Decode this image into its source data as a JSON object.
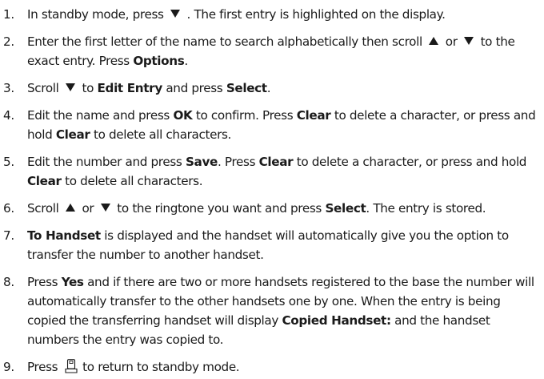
{
  "steps": [
    {
      "number": "1.",
      "parts": [
        "In standby mode, press ",
        " . The first entry is highlighted on the display."
      ],
      "icons": [
        "arrow-down-icon"
      ]
    },
    {
      "number": "2.",
      "parts": [
        "Enter the first letter of the name to search alphabetically then scroll ",
        " or ",
        " to the exact entry. Press ",
        "Options",
        "."
      ],
      "icons": [
        "arrow-up-icon",
        "arrow-down-icon"
      ]
    },
    {
      "number": "3.",
      "parts": [
        "Scroll ",
        " to ",
        "Edit Entry",
        " and press ",
        "Select",
        "."
      ],
      "icons": [
        "arrow-down-icon"
      ]
    },
    {
      "number": "4.",
      "parts": [
        "Edit the name and press ",
        "OK",
        " to confirm. Press ",
        "Clear",
        " to delete a character, or press and hold ",
        "Clear",
        " to delete all characters."
      ]
    },
    {
      "number": "5.",
      "parts": [
        "Edit the number and press ",
        "Save",
        ". Press ",
        "Clear",
        " to delete a character, or press and hold ",
        "Clear",
        " to delete all characters."
      ]
    },
    {
      "number": "6.",
      "parts": [
        "Scroll ",
        " or ",
        " to the ringtone you want and press ",
        "Select",
        ". The entry is stored."
      ],
      "icons": [
        "arrow-up-icon",
        "arrow-down-icon"
      ]
    },
    {
      "number": "7.",
      "parts": [
        "To Handset",
        " is displayed and the handset will automatically give you the option to transfer the number to another handset."
      ]
    },
    {
      "number": "8.",
      "parts": [
        "Press ",
        "Yes",
        " and if there are two or more handsets registered to the base the number will automatically transfer to the other handsets one by one. When the entry is being copied the transferring handset will display ",
        "Copied Handset:",
        " and the handset numbers the entry was copied to."
      ]
    },
    {
      "number": "9.",
      "parts": [
        "Press ",
        " to return to standby mode."
      ],
      "icons": [
        "end-call-handset-icon"
      ]
    }
  ]
}
